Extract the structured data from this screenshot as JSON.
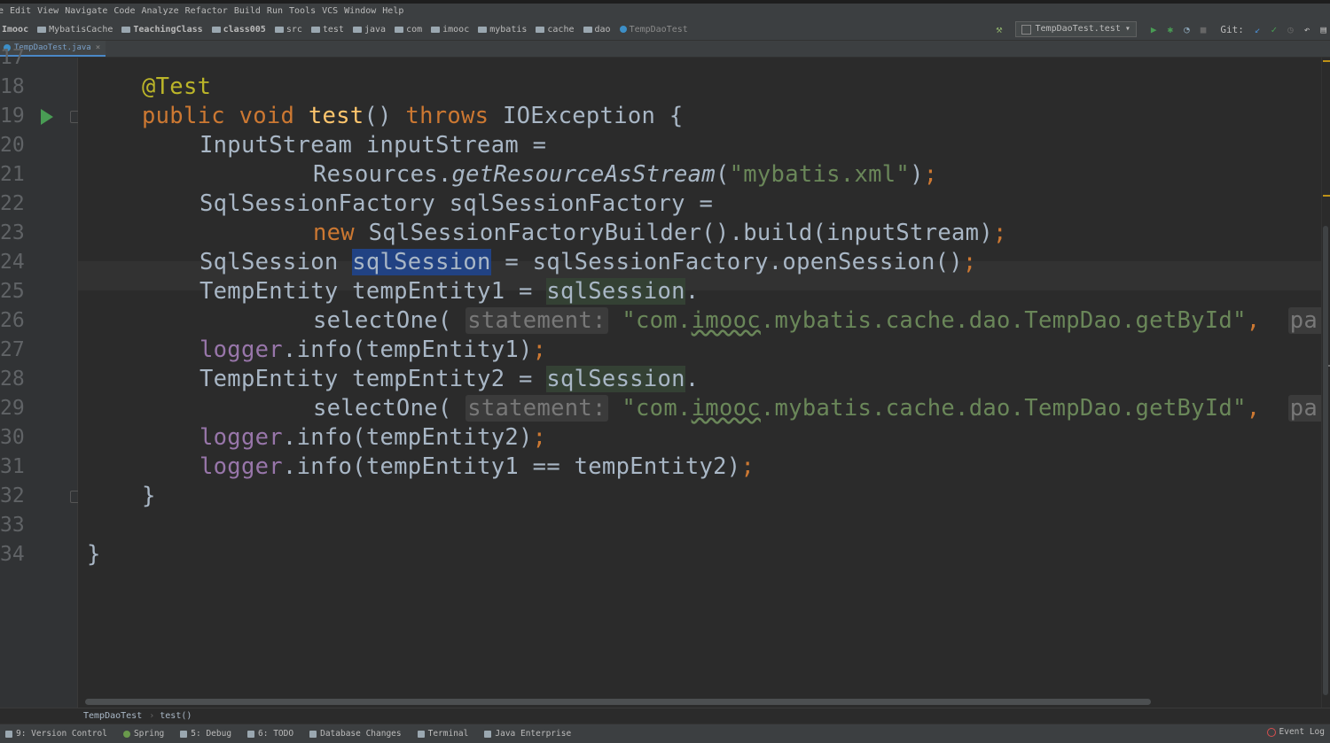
{
  "menu": [
    "e",
    "Edit",
    "View",
    "Navigate",
    "Code",
    "Analyze",
    "Refactor",
    "Build",
    "Run",
    "Tools",
    "VCS",
    "Window",
    "Help"
  ],
  "breadcrumbs": [
    "Imooc",
    "MybatisCache",
    "TeachingClass",
    "class005",
    "src",
    "test",
    "java",
    "com",
    "imooc",
    "mybatis",
    "cache",
    "dao"
  ],
  "active_class": "TempDaoTest",
  "run_config": "TempDaoTest.test",
  "git_label": "Git:",
  "tab": {
    "label": "TempDaoTest.java",
    "close": "×"
  },
  "line_numbers": [
    "17",
    "18",
    "19",
    "20",
    "21",
    "22",
    "23",
    "24",
    "25",
    "26",
    "27",
    "28",
    "29",
    "30",
    "31",
    "32",
    "33",
    "34"
  ],
  "code": {
    "l18": "@Test",
    "l19_kw1": "public",
    "l19_kw2": "void",
    "l19_fn": "test",
    "l19_mid": "() ",
    "l19_kw3": "throws",
    "l19_rest": " IOException {",
    "l20": "InputStream inputStream =",
    "l21_a": "Resources.",
    "l21_fn": "getResourceAsStream",
    "l21_b": "(",
    "l21_str": "\"mybatis.xml\"",
    "l21_c": ")",
    "l22": "SqlSessionFactory sqlSessionFactory =",
    "l23_kw": "new",
    "l23_rest": " SqlSessionFactoryBuilder().build(inputStream)",
    "l24_a": "SqlSession ",
    "l24_hl": "sqlSession",
    "l24_b": " = sqlSessionFactory.openSession()",
    "l25_a": "TempEntity tempEntity1 = ",
    "l25_ref": "sqlSession",
    "l25_b": ".",
    "l26_a": "selectOne(",
    "l26_hint": "statement:",
    "l26_str1": "\"com.",
    "l26_typo": "imooc",
    "l26_str2": ".mybatis.cache.dao.TempDao.getById\"",
    "l26_b": ", ",
    "l26_hint2": "para",
    "l27_field": "logger",
    "l27_rest": ".info(tempEntity1)",
    "l28_a": "TempEntity tempEntity2 = ",
    "l28_ref": "sqlSession",
    "l28_b": ".",
    "l29_a": "selectOne(",
    "l29_hint": "statement:",
    "l29_str1": "\"com.",
    "l29_typo": "imooc",
    "l29_str2": ".mybatis.cache.dao.TempDao.getById\"",
    "l29_b": ", ",
    "l29_hint2": "para",
    "l30_field": "logger",
    "l30_rest": ".info(tempEntity2)",
    "l31_field": "logger",
    "l31_rest": ".info(tempEntity1 == tempEntity2)",
    "semi": ";",
    "l32": "}",
    "l34": "}"
  },
  "editor_breadcrumb": {
    "file": "TempDaoTest",
    "method": "test()"
  },
  "tool_windows": [
    "9: Version Control",
    "Spring",
    "5: Debug",
    "6: TODO",
    "Database Changes",
    "Terminal",
    "Java Enterprise"
  ],
  "event_log": "Event Log",
  "colors": {
    "keyword": "#cc7832",
    "string": "#6a8759",
    "annotation": "#bbb529",
    "method": "#ffc66d",
    "field": "#9876aa",
    "selection": "#214283"
  }
}
